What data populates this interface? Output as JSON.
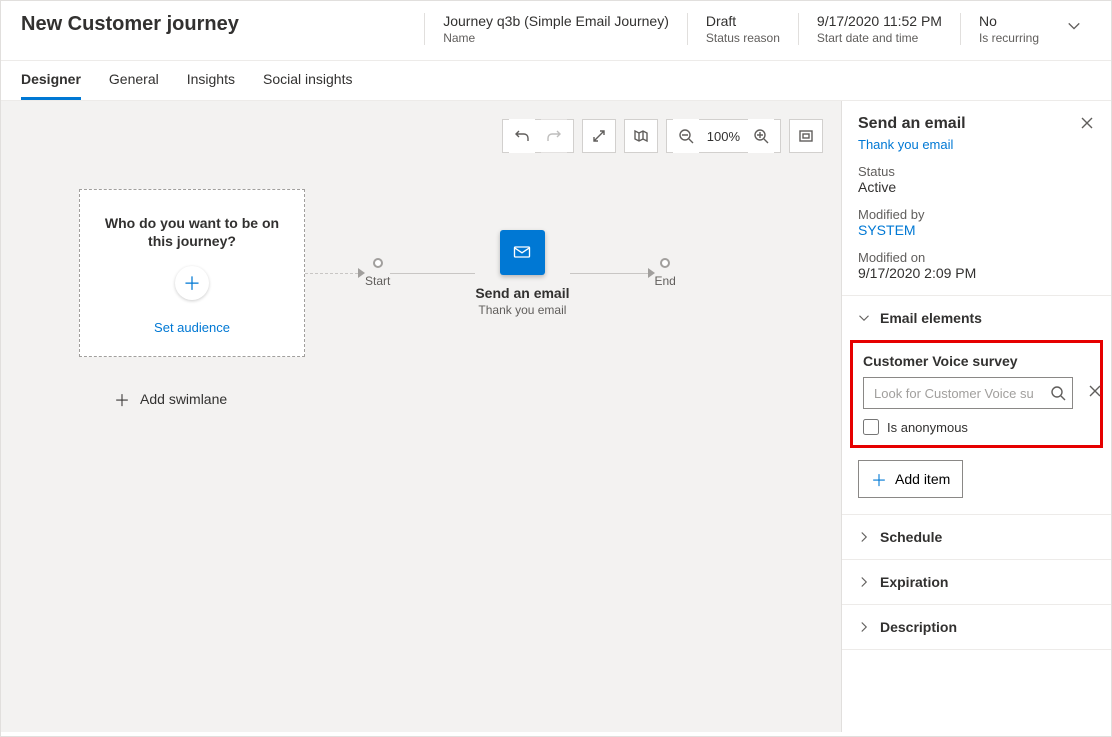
{
  "header": {
    "title": "New Customer journey",
    "meta": [
      {
        "value": "Journey q3b (Simple Email Journey)",
        "label": "Name"
      },
      {
        "value": "Draft",
        "label": "Status reason"
      },
      {
        "value": "9/17/2020 11:52 PM",
        "label": "Start date and time"
      },
      {
        "value": "No",
        "label": "Is recurring"
      }
    ]
  },
  "tabs": [
    "Designer",
    "General",
    "Insights",
    "Social insights"
  ],
  "toolbar": {
    "zoom": "100%"
  },
  "canvas": {
    "audience": {
      "question_l1": "Who do you want to be on",
      "question_l2": "this journey?",
      "set_link": "Set audience"
    },
    "start_label": "Start",
    "end_label": "End",
    "email_tile": {
      "title": "Send an email",
      "subtitle": "Thank you email"
    },
    "add_swimlane": "Add swimlane"
  },
  "side": {
    "title": "Send an email",
    "sublink": "Thank you email",
    "status_label": "Status",
    "status_value": "Active",
    "modby_label": "Modified by",
    "modby_value": "SYSTEM",
    "modon_label": "Modified on",
    "modon_value": "9/17/2020 2:09 PM",
    "elements_head": "Email elements",
    "survey_label": "Customer Voice survey",
    "survey_placeholder": "Look for Customer Voice su",
    "anon_label": "Is anonymous",
    "add_item": "Add item",
    "acc_schedule": "Schedule",
    "acc_expiration": "Expiration",
    "acc_description": "Description"
  }
}
